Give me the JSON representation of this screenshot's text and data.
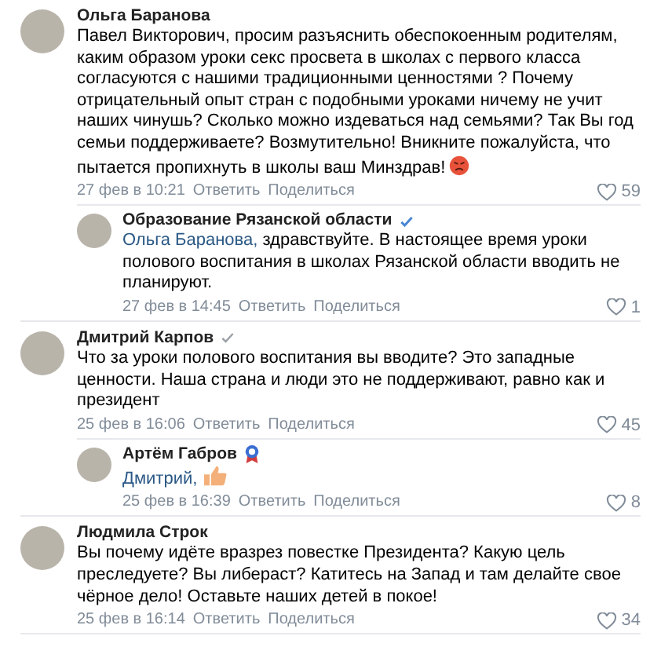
{
  "comments": [
    {
      "author": "Ольга Баранова",
      "text": "Павел Викторович, просим разъяснить обеспокоенным родителям, каким образом уроки секс просвета в школах с первого класса согласуются с нашими традиционными ценностями ? Почему отрицательный опыт стран с подобными уроками ничему не учит наших чинушь? Сколько можно издеваться над семьями? Так Вы год семьи поддерживаете? Возмутительно! Вникните пожалуйста, что пытается пропихнуть в школы ваш Минздрав!",
      "emoji": {
        "kind": "angry"
      },
      "date": "27 фев в 10:21",
      "reply": "Ответить",
      "share": "Поделиться",
      "likes": "59",
      "replies": [
        {
          "author": "Образование Рязанской области",
          "badge": {
            "kind": "verified"
          },
          "mention": "Ольга Баранова,",
          "text": "здравствуйте. В настоящее время уроки полового воспитания в школах Рязанской области вводить не планируют.",
          "date": "27 фев в 14:45",
          "reply": "Ответить",
          "share": "Поделиться",
          "likes": "1"
        }
      ]
    },
    {
      "author": "Дмитрий Карпов",
      "badge": {
        "kind": "check"
      },
      "text": "Что за уроки полового воспитания вы вводите? Это западные ценности. Наша страна и люди это не поддерживают, равно как и президент",
      "date": "25 фев в 16:06",
      "reply": "Ответить",
      "share": "Поделиться",
      "likes": "45",
      "replies": [
        {
          "author": "Артём Габров",
          "badge": {
            "kind": "ribbon"
          },
          "mention": "Дмитрий,",
          "emoji": {
            "kind": "thumbs-up"
          },
          "date": "25 фев в 16:39",
          "reply": "Ответить",
          "share": "Поделиться",
          "likes": "8"
        }
      ]
    },
    {
      "author": "Людмила Строк",
      "text": "Вы почему идёте вразрез повестке Президента? Какую цель преследуете? Вы либераст? Катитесь на Запад и там делайте свое чёрное дело! Оставьте наших детей в покое!",
      "date": "25 фев в 16:14",
      "reply": "Ответить",
      "share": "Поделиться",
      "likes": "34"
    }
  ]
}
